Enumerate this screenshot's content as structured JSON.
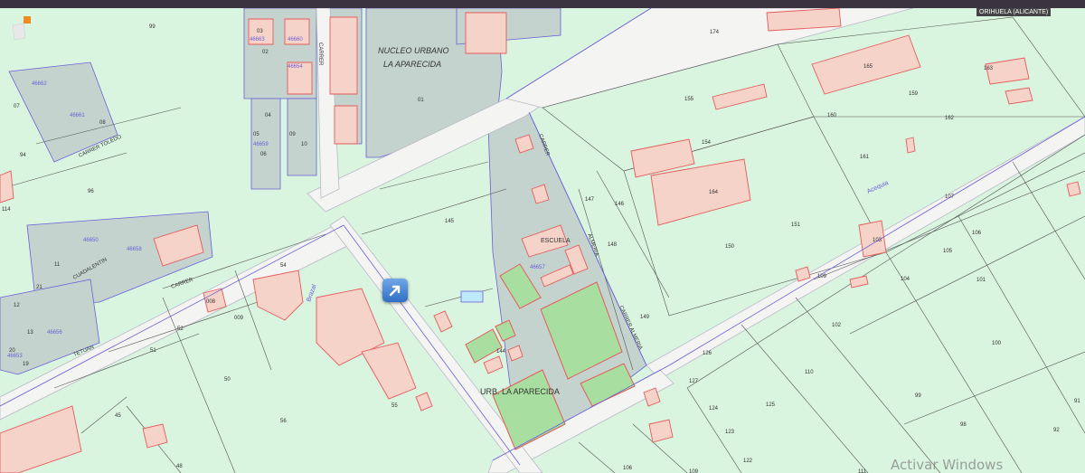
{
  "region_label": "ORIHUELA (ALICANTE)",
  "watermark": "Activar Windows",
  "blocks": [
    {
      "name": "nucleo-urbano",
      "label": "NUCLEO URBANO\nLA APARECIDA"
    },
    {
      "name": "urb-aparecida",
      "label": "URB. LA APARECIDA"
    },
    {
      "name": "escuela",
      "label": "ESCUELA"
    }
  ],
  "streets": [
    "CARRER",
    "CARRER",
    "Acequia",
    "Brazal",
    "CARRER TOLEDO",
    "CUADALENTIN",
    "TETUAN",
    "ALMERIA",
    "CARRER",
    "CARRER ALMERIA"
  ],
  "parcel_numbers": [
    "99",
    "94",
    "96",
    "114",
    "174",
    "155",
    "165",
    "159",
    "163",
    "160",
    "162",
    "154",
    "164",
    "147",
    "146",
    "145",
    "151",
    "150",
    "161",
    "107",
    "106",
    "105",
    "104",
    "103",
    "101",
    "102",
    "100",
    "109",
    "148",
    "149",
    "126",
    "127",
    "124",
    "125",
    "123",
    "122",
    "110",
    "99",
    "98",
    "92",
    "91",
    "111",
    "106",
    "109",
    "144",
    "55",
    "56",
    "50",
    "51",
    "52",
    "54",
    "45",
    "48",
    "01",
    "02",
    "03",
    "04",
    "05",
    "06",
    "09",
    "10",
    "008",
    "009",
    "07",
    "08",
    "12",
    "13",
    "11",
    "20",
    "21",
    "19"
  ],
  "ref_codes": [
    "46663",
    "46654",
    "46660",
    "46659",
    "46657",
    "46662",
    "46661",
    "46658",
    "46656",
    "46653",
    "46650"
  ],
  "nav_button_icon": "arrow-northeast-icon",
  "colors": {
    "background": "#d9f4df",
    "urban_block": "#c6d4ce",
    "building": "#f6d3c8",
    "outline_red": "#e55b5b",
    "outline_purple": "#6a5fd8",
    "road": "#f4f4f2"
  }
}
